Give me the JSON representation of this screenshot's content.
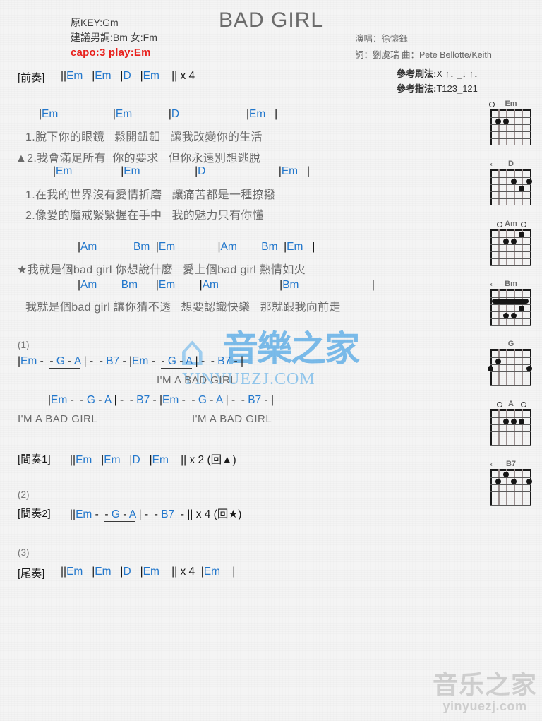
{
  "header": {
    "title": "BAD GIRL",
    "orig_key": "原KEY:Gm",
    "suggested_key": "建議男調:Bm 女:Fm",
    "capo": "capo:3 play:Em",
    "capo_color": "#e8201c",
    "singer": "演唱：徐懷鈺",
    "writers": "詞：劉虞瑞   曲：Pete Bellotte/Keith",
    "strum_label": "參考刷法:",
    "strum_value": "X ↑↓ _↓ ↑↓",
    "fingering_label": "參考指法:",
    "fingering_value": "T123_121"
  },
  "intro": {
    "section": "[前奏]",
    "line": "||Em   |Em   |D   |Em    || x 4"
  },
  "verse1": {
    "chords": "|Em              |Em          |D                  |Em    |",
    "lyric1": "1.脫下你的眼鏡   鬆開鈕釦   讓我改變你的生活",
    "lyric2": "▲2.我會滿足所有  你的要求   但你永遠別想逃脫",
    "chords2": "|Em            |Em           |D                 |Em   |",
    "lyric3": "1.在我的世界沒有愛情折磨   讓痛苦都是一種撩撥",
    "lyric4": "2.像愛的魔戒緊緊握在手中   我的魅力只有你懂"
  },
  "chorus": {
    "chords1": "|Am          Bm   |Em         |Am     Bm   |Em    |",
    "lyric1": "★我就是個bad girl 你想說什麼   愛上個bad girl 熱情如火",
    "chords2": "|Am      Bm     |Em    |Am              |Bm                  |",
    "lyric2": "我就是個bad girl 讓你猜不透   想要認識快樂   那就跟我向前走"
  },
  "bridge1": {
    "number": "(1)",
    "eng_mid": "I'M A BAD GIRL",
    "eng_left": "I'M A BAD GIRL",
    "eng_right": "I'M A BAD GIRL"
  },
  "interlude1": {
    "section": "[間奏1]",
    "line": "||Em   |Em   |D   |Em    || x 2 (回▲)"
  },
  "interlude2": {
    "number": "(2)",
    "section": "[間奏2]",
    "tail": "| -  - B7  -   || x 4 (回★)"
  },
  "outro": {
    "number": "(3)",
    "section": "[尾奏]",
    "line": "||Em   |Em   |D   |Em    || x 4  |Em    |"
  },
  "chord_tokens": {
    "Em": "Em",
    "D": "D",
    "Am": "Am",
    "Bm": "Bm",
    "G": "G",
    "A": "A",
    "B7": "B7"
  },
  "diagrams": [
    {
      "name": "Em",
      "markers": "o . . . . ."
    },
    {
      "name": "D",
      "markers": "x"
    },
    {
      "name": "Am",
      "markers": "o o"
    },
    {
      "name": "Bm",
      "markers": "x barre"
    },
    {
      "name": "G",
      "markers": ""
    },
    {
      "name": "A",
      "markers": "o o"
    },
    {
      "name": "B7",
      "markers": "x"
    }
  ],
  "watermark": {
    "center_cn": "音樂之家",
    "center_url": "YINYUEZJ.COM",
    "bottom_cn": "音乐之家",
    "bottom_url": "yinyuezj.com"
  }
}
